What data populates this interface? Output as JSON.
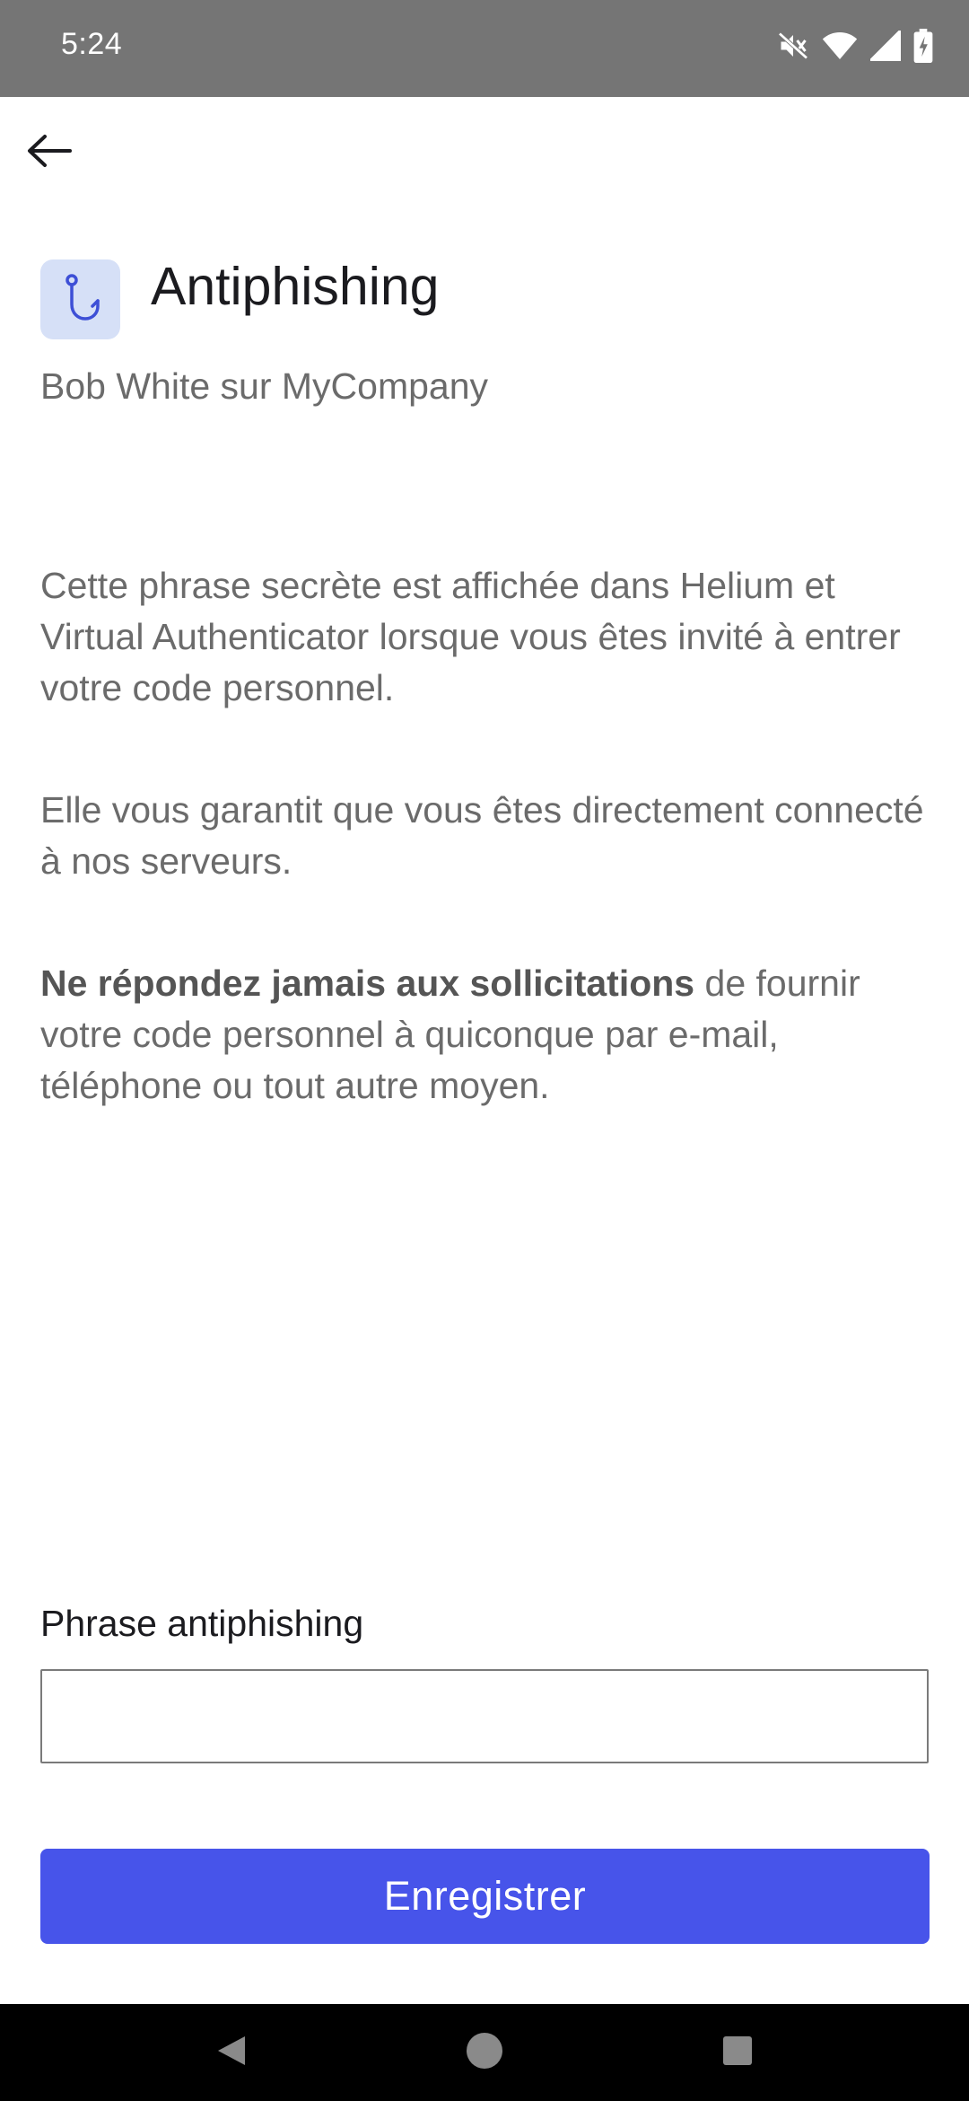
{
  "status_bar": {
    "time": "5:24",
    "icons": [
      "mute-icon",
      "wifi-icon",
      "signal-icon",
      "battery-charging-icon"
    ]
  },
  "app_bar": {
    "back_icon": "arrow-left-icon"
  },
  "header": {
    "icon": "fishing-hook-icon",
    "title": "Antiphishing",
    "subtitle": "Bob White sur MyCompany"
  },
  "body": {
    "paragraph1": "Cette phrase secrète est affichée dans Helium et Virtual Authenticator lorsque vous êtes invité à entrer votre code personnel.",
    "paragraph2": "Elle vous garantit que vous êtes directement connecté à nos serveurs.",
    "paragraph3_bold": "Ne répondez jamais aux sollicitations",
    "paragraph3_rest": " de fournir votre code personnel à quiconque par e-mail, téléphone ou tout autre moyen."
  },
  "form": {
    "label": "Phrase antiphishing",
    "value": "",
    "placeholder": ""
  },
  "actions": {
    "save_label": "Enregistrer"
  },
  "colors": {
    "status_bar_bg": "#757575",
    "accent": "#4754ea",
    "icon_tile_bg": "#d6e0f7",
    "icon_stroke": "#3d4fd6"
  },
  "nav_bar": {
    "buttons": [
      "back-triangle-icon",
      "home-circle-icon",
      "recents-square-icon"
    ]
  }
}
